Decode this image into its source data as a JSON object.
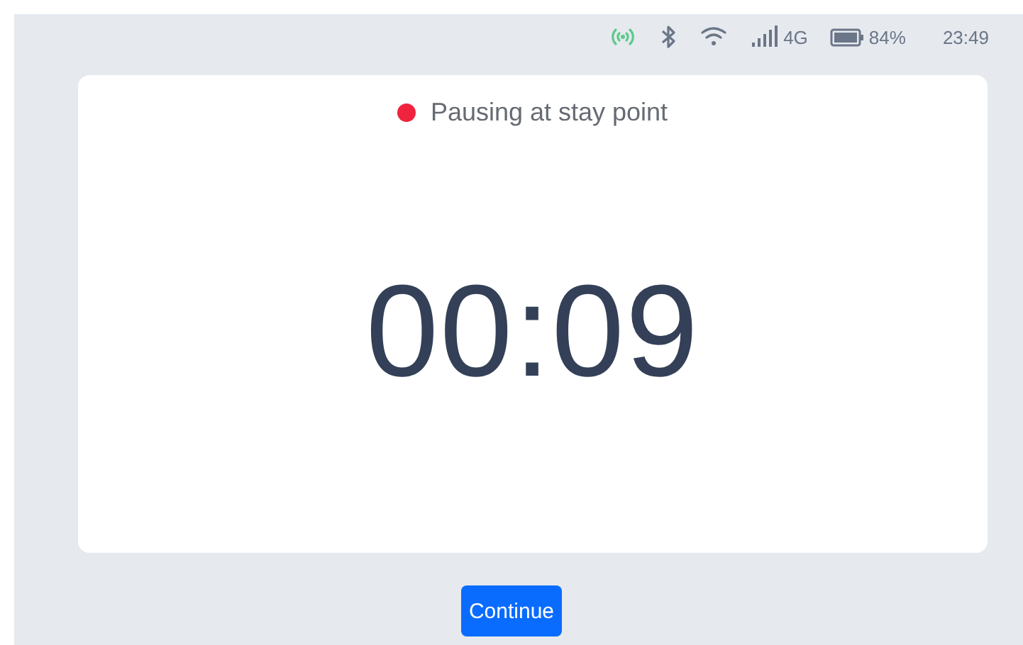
{
  "status_bar": {
    "network": "4G",
    "battery": "84%",
    "time": "23:49"
  },
  "status": {
    "text": "Pausing at stay point"
  },
  "timer": "00:09",
  "buttons": [
    "Continue"
  ]
}
